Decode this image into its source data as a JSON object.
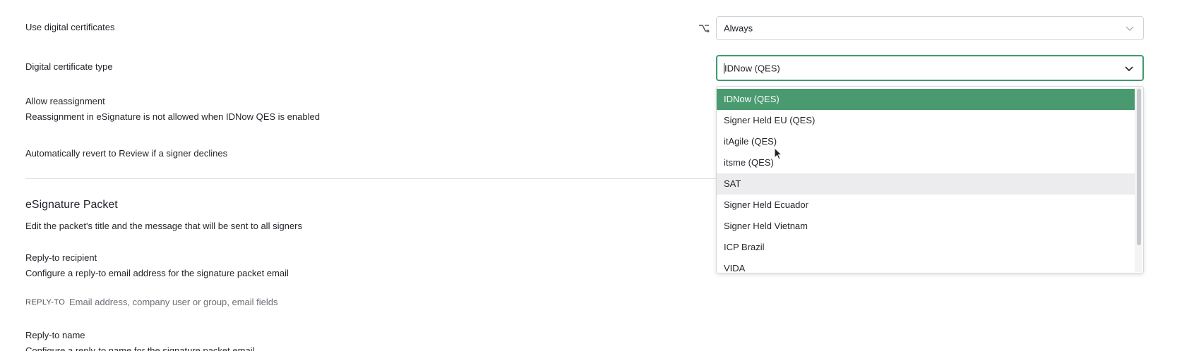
{
  "settings": {
    "use_digital_certificates": {
      "label": "Use digital certificates",
      "value": "Always"
    },
    "digital_certificate_type": {
      "label": "Digital certificate type",
      "value": "IDNow (QES)"
    },
    "allow_reassignment": {
      "label": "Allow reassignment",
      "description": "Reassignment in eSignature is not allowed when IDNow QES is enabled"
    },
    "auto_revert": {
      "label": "Automatically revert to Review if a signer declines"
    }
  },
  "packet": {
    "title": "eSignature Packet",
    "description": "Edit the packet's title and the message that will be sent to all signers",
    "reply_to_recipient": {
      "label": "Reply-to recipient",
      "description": "Configure a reply-to email address for the signature packet email",
      "field_label": "REPLY-TO",
      "placeholder": "Email address, company user or group, email fields"
    },
    "reply_to_name": {
      "label": "Reply-to name",
      "description": "Configure a reply-to name for the signature packet email"
    }
  },
  "dropdown": {
    "options": [
      "IDNow (QES)",
      "Signer Held EU (QES)",
      "itAgile (QES)",
      "itsme (QES)",
      "SAT",
      "Signer Held Ecuador",
      "Signer Held Vietnam",
      "ICP Brazil",
      "VIDA"
    ],
    "selected_index": 0,
    "hovered_index": 4
  },
  "colors": {
    "accent": "#4a9a6f",
    "focus_border": "#3f9a6e",
    "hover": "#ececef"
  },
  "icons": {
    "conditional": "branch-icon",
    "dropdown_closed": "chevron-down-icon",
    "dropdown_open": "chevron-down-icon",
    "pointer": "mouse-cursor-icon"
  }
}
